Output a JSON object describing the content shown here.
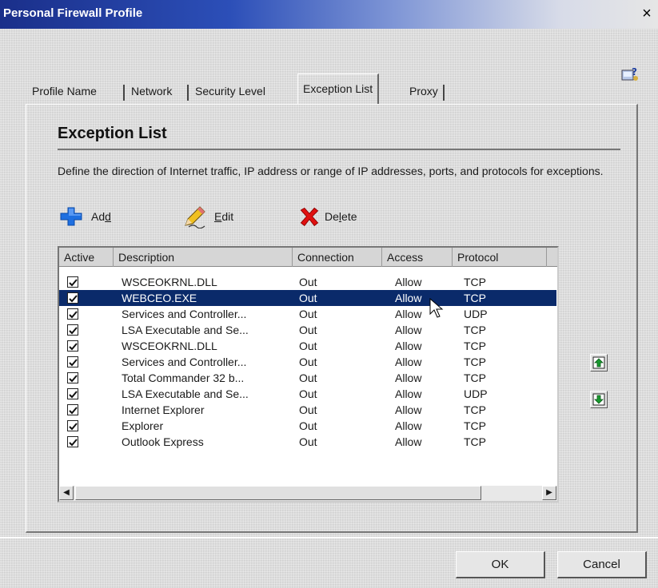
{
  "window": {
    "title": "Personal Firewall Profile",
    "close_glyph": "×"
  },
  "help_icon": "help-icon",
  "tabs": [
    {
      "label": "Profile Name",
      "active": false
    },
    {
      "label": "Network",
      "active": false
    },
    {
      "label": "Security Level",
      "active": false
    },
    {
      "label": "Exception List",
      "active": true
    },
    {
      "label": "Proxy",
      "active": false
    }
  ],
  "page": {
    "heading": "Exception List",
    "description": "Define the direction of Internet traffic, IP address or range of IP addresses, ports, and protocols for exceptions."
  },
  "toolbar": {
    "add": {
      "pre": "Ad",
      "mnemonic": "d",
      "post": "",
      "icon": "plus-icon"
    },
    "edit": {
      "pre": "",
      "mnemonic": "E",
      "post": "dit",
      "icon": "pencil-icon"
    },
    "delete": {
      "pre": "De",
      "mnemonic": "l",
      "post": "ete",
      "icon": "red-x-icon"
    }
  },
  "table": {
    "columns": [
      "Active",
      "Description",
      "Connection",
      "Access",
      "Protocol"
    ],
    "rows": [
      {
        "active": true,
        "description": "WSCEOKRNL.DLL",
        "connection": "Out",
        "access": "Allow",
        "protocol": "TCP",
        "selected": false
      },
      {
        "active": true,
        "description": "WEBCEO.EXE",
        "connection": "Out",
        "access": "Allow",
        "protocol": "TCP",
        "selected": true
      },
      {
        "active": true,
        "description": "Services and Controller...",
        "connection": "Out",
        "access": "Allow",
        "protocol": "UDP",
        "selected": false
      },
      {
        "active": true,
        "description": "LSA Executable and Se...",
        "connection": "Out",
        "access": "Allow",
        "protocol": "TCP",
        "selected": false
      },
      {
        "active": true,
        "description": "WSCEOKRNL.DLL",
        "connection": "Out",
        "access": "Allow",
        "protocol": "TCP",
        "selected": false
      },
      {
        "active": true,
        "description": "Services and Controller...",
        "connection": "Out",
        "access": "Allow",
        "protocol": "TCP",
        "selected": false
      },
      {
        "active": true,
        "description": "Total Commander 32 b...",
        "connection": "Out",
        "access": "Allow",
        "protocol": "TCP",
        "selected": false
      },
      {
        "active": true,
        "description": "LSA Executable and Se...",
        "connection": "Out",
        "access": "Allow",
        "protocol": "UDP",
        "selected": false
      },
      {
        "active": true,
        "description": "Internet Explorer",
        "connection": "Out",
        "access": "Allow",
        "protocol": "TCP",
        "selected": false
      },
      {
        "active": true,
        "description": "Explorer",
        "connection": "Out",
        "access": "Allow",
        "protocol": "TCP",
        "selected": false
      },
      {
        "active": true,
        "description": "Outlook Express",
        "connection": "Out",
        "access": "Allow",
        "protocol": "TCP",
        "selected": false
      }
    ]
  },
  "side_buttons": {
    "move_up_icon": "move-up-icon",
    "move_down_icon": "move-down-icon"
  },
  "buttons": {
    "ok": "OK",
    "cancel": "Cancel"
  },
  "colors": {
    "selection": "#0a2a6a",
    "title_gradient_start": "#1a2f8a",
    "delete_red": "#e01010",
    "add_blue": "#1e6fe0"
  }
}
